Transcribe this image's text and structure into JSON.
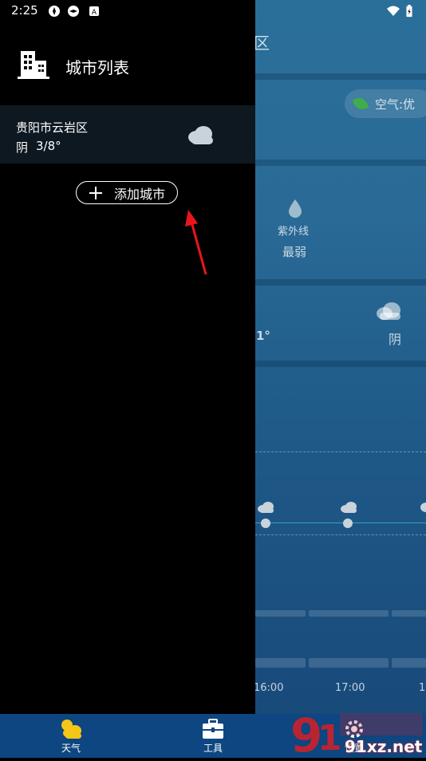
{
  "status": {
    "time": "2:25"
  },
  "drawer": {
    "title": "城市列表",
    "cities": [
      {
        "name": "贵阳市云岩区",
        "weather": "阴",
        "temp": "3/8°"
      }
    ],
    "add_city_label": "添加城市"
  },
  "background": {
    "title_fragment": "区",
    "air_quality": "空气:优",
    "uv_label": "紫外线",
    "uv_value": "最弱",
    "temp_fragment": "1°",
    "weather": "阴",
    "times": [
      "16:00",
      "17:00",
      "1"
    ]
  },
  "tabs": [
    {
      "label": "天气",
      "icon": "weather-icon"
    },
    {
      "label": "工具",
      "icon": "toolbox-icon"
    },
    {
      "label": "设置",
      "icon": "settings-icon"
    }
  ],
  "watermark": "91xz.net",
  "colors": {
    "tabbar": "#0d4680",
    "accent_yellow": "#f5c518",
    "arrow": "#e8161c"
  }
}
